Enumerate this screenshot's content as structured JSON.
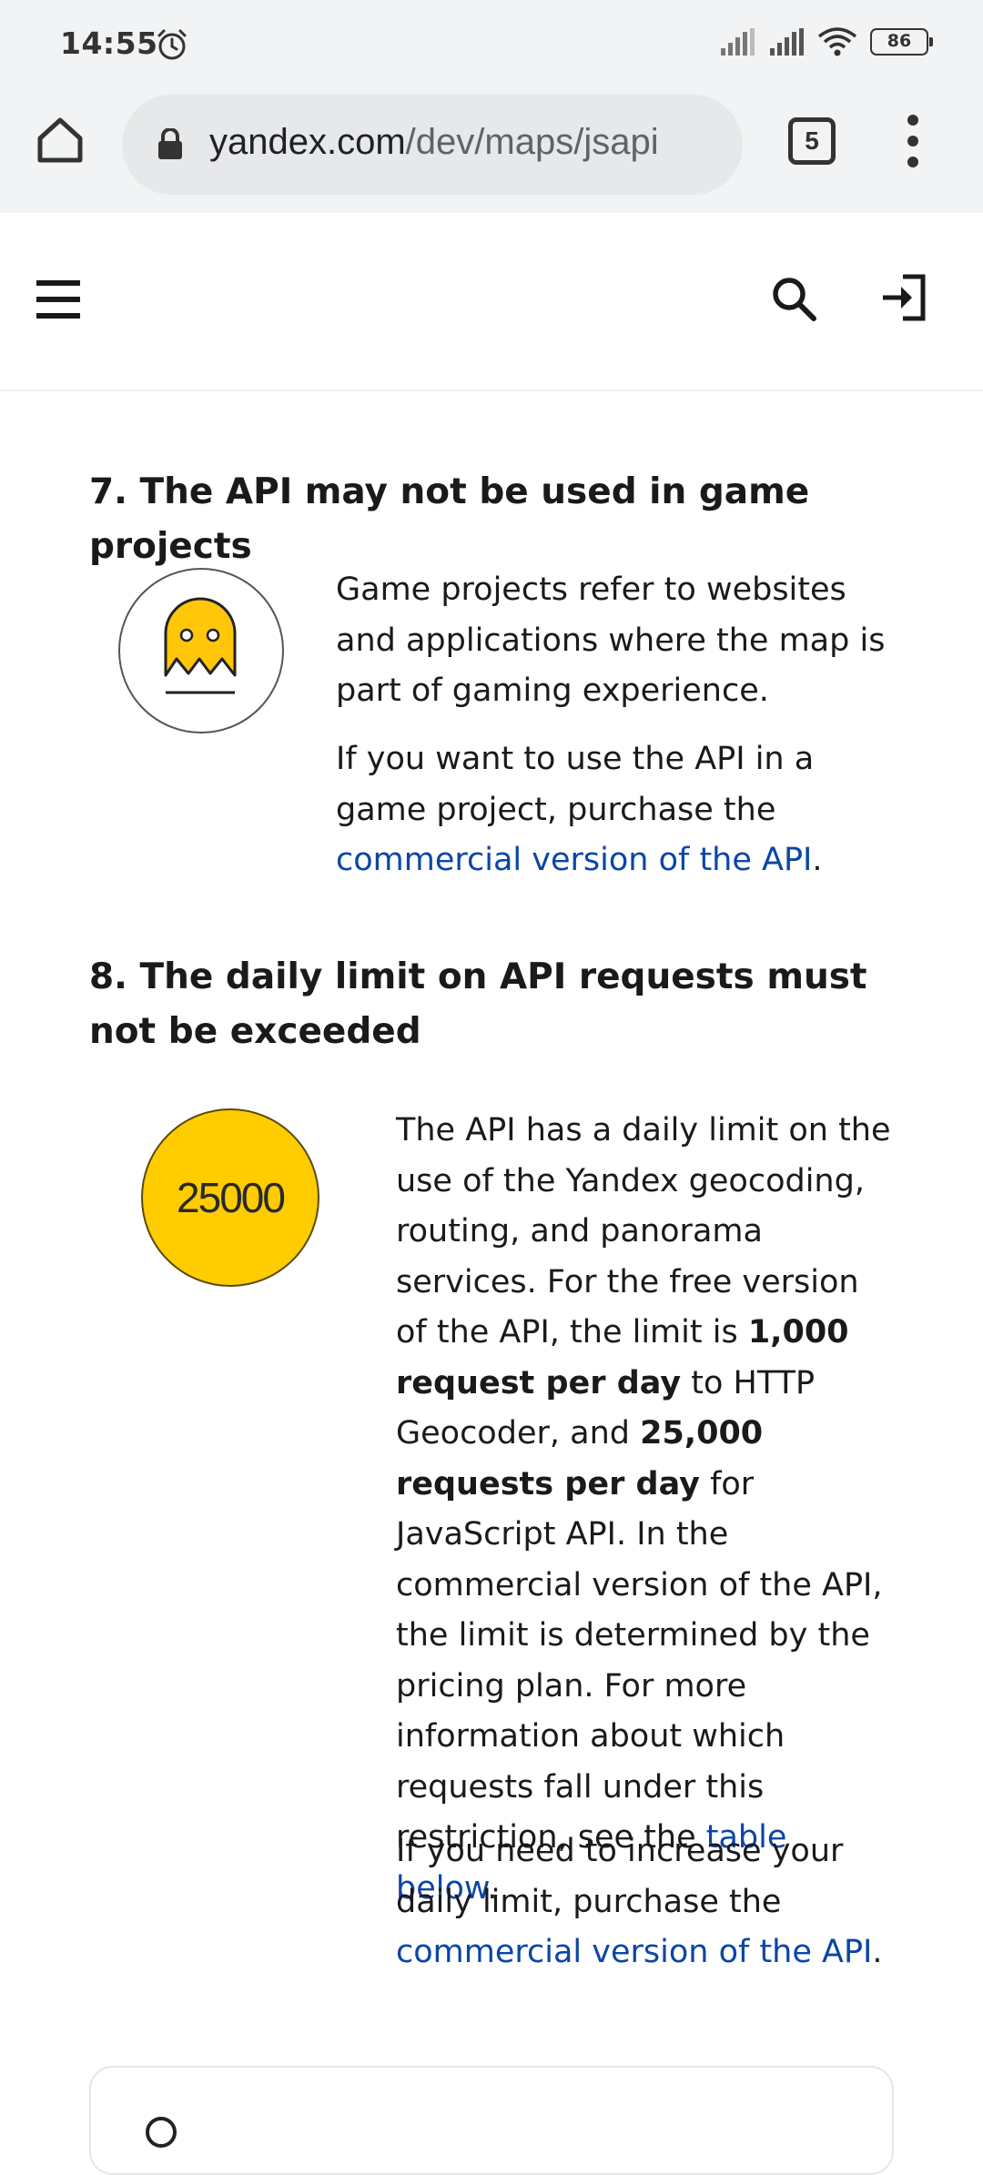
{
  "status_bar": {
    "time": "14:55",
    "battery": "86"
  },
  "browser": {
    "url_domain": "yandex.com",
    "url_path": "/dev/maps/jsapi",
    "tab_count": "5"
  },
  "sections": [
    {
      "heading": "7. The API may not be used in game projects",
      "p1": "Game projects refer to websites and applications where the map is part of gaming experience.",
      "p2_before": "If you want to use the API in a game project, purchase the ",
      "p2_link": "commercial version of the API",
      "p2_after": "."
    },
    {
      "heading": "8. The daily limit on API requests must not be exceeded",
      "badge": "25000",
      "p1_a": "The API has a daily limit on the use of the Yandex geocoding, routing, and panorama services. For the free version of the API, the limit is ",
      "p1_bold1": "1,000 request per day",
      "p1_b": " to HTTP Geocoder, and ",
      "p1_bold2": "25,000 requests per day",
      "p1_c": " for JavaScript API. In the commercial version of the API, the limit is determined by the pricing plan. For more information about which requests fall under this restriction, see the ",
      "p1_link": "table below",
      "p1_d": ".",
      "p2_before": "If you need to increase your daily limit, purchase the ",
      "p2_link": "commercial version of the API",
      "p2_after": "."
    }
  ],
  "icons": {
    "alarm": "alarm-clock-icon",
    "signal": "signal-icon",
    "wifi": "wifi-icon",
    "home": "home-icon",
    "lock": "lock-icon",
    "menu": "more-vert-icon",
    "hamburger": "hamburger-icon",
    "search": "search-icon",
    "login": "login-icon",
    "ghost": "ghost-icon"
  },
  "colors": {
    "link": "#0b46a6",
    "badge": "#ffcc00",
    "ghost": "#ffc60a"
  }
}
